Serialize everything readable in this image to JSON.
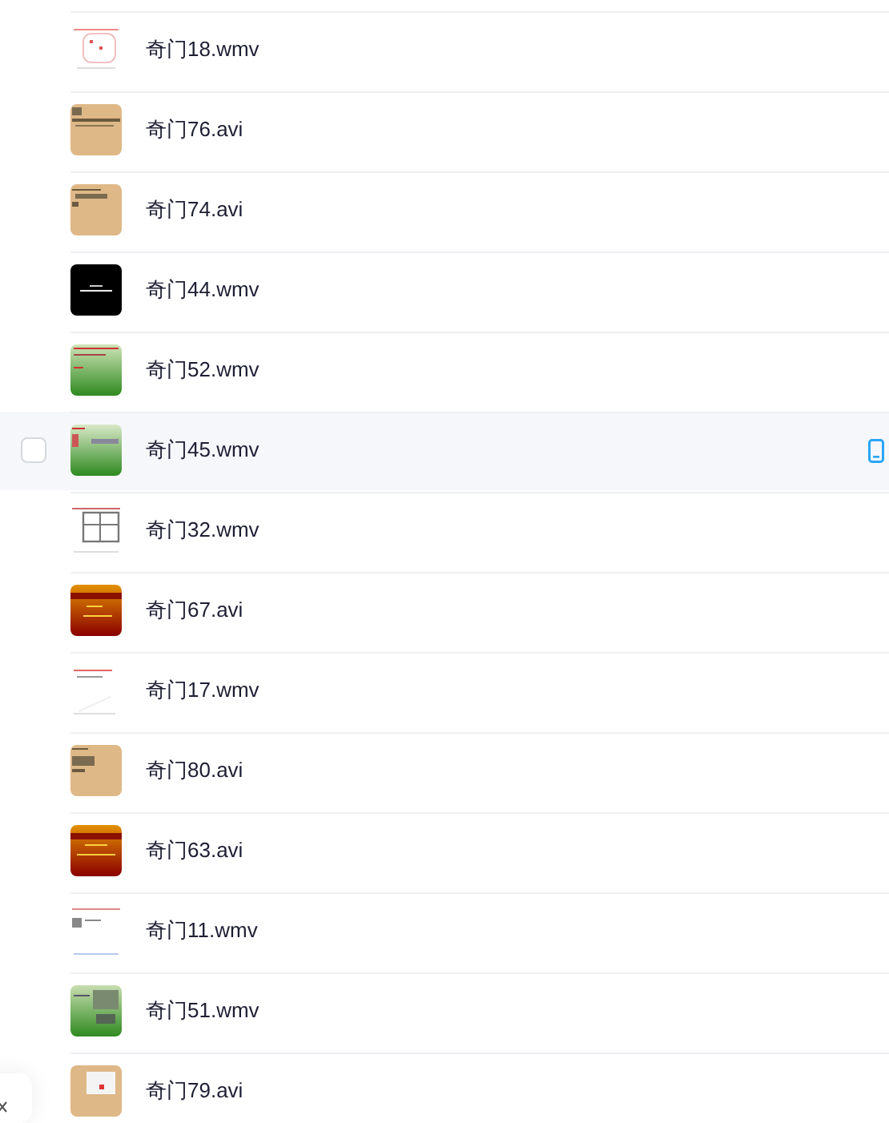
{
  "files": [
    {
      "name": "奇门18.wmv",
      "hovered": false,
      "checked": false
    },
    {
      "name": "奇门76.avi",
      "hovered": false,
      "checked": false
    },
    {
      "name": "奇门74.avi",
      "hovered": false,
      "checked": false
    },
    {
      "name": "奇门44.wmv",
      "hovered": false,
      "checked": false
    },
    {
      "name": "奇门52.wmv",
      "hovered": false,
      "checked": false
    },
    {
      "name": "奇门45.wmv",
      "hovered": true,
      "checked": false
    },
    {
      "name": "奇门32.wmv",
      "hovered": false,
      "checked": false
    },
    {
      "name": "奇门67.avi",
      "hovered": false,
      "checked": false
    },
    {
      "name": "奇门17.wmv",
      "hovered": false,
      "checked": false
    },
    {
      "name": "奇门80.avi",
      "hovered": false,
      "checked": false
    },
    {
      "name": "奇门63.avi",
      "hovered": false,
      "checked": false
    },
    {
      "name": "奇门11.wmv",
      "hovered": false,
      "checked": false
    },
    {
      "name": "奇门51.wmv",
      "hovered": false,
      "checked": false
    },
    {
      "name": "奇门79.avi",
      "hovered": false,
      "checked": false
    }
  ]
}
